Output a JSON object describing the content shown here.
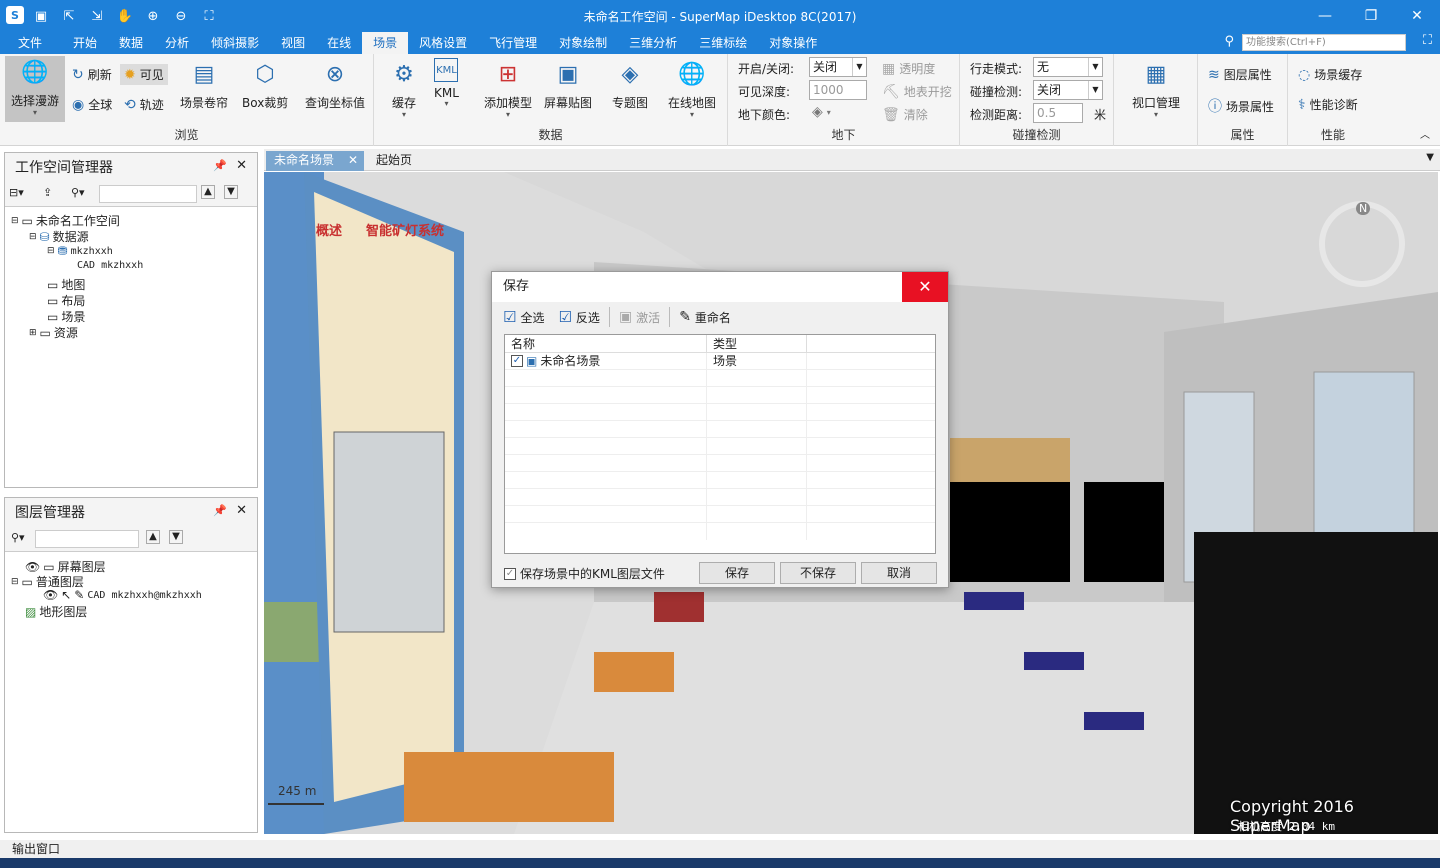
{
  "window": {
    "title": "未命名工作空间 - SuperMap iDesktop 8C(2017)"
  },
  "menu": {
    "items": [
      "文件",
      "开始",
      "数据",
      "分析",
      "倾斜摄影",
      "视图",
      "在线",
      "场景",
      "风格设置",
      "飞行管理",
      "对象绘制",
      "三维分析",
      "三维标绘",
      "对象操作"
    ],
    "active": "场景",
    "search_placeholder": "功能搜索(Ctrl+F)"
  },
  "ribbon": {
    "browse": {
      "label": "浏览",
      "select_roam": "选择漫游",
      "refresh": "刷新",
      "visible": "可见",
      "full_globe": "全球",
      "track": "轨迹",
      "scene_curtain": "场景卷帘",
      "box_clip": "Box裁剪",
      "query_coord": "查询坐标值"
    },
    "data": {
      "label": "数据",
      "cache": "缓存",
      "kml": "KML",
      "add_model": "添加模型",
      "screen_map": "屏幕贴图",
      "thematic": "专题图",
      "online_map": "在线地图"
    },
    "underground": {
      "label": "地下",
      "onoff_label": "开启/关闭:",
      "onoff_value": "关闭",
      "depth_label": "可见深度:",
      "depth_value": "1000",
      "color_label": "地下颜色:",
      "transparency": "透明度",
      "excavate": "地表开挖",
      "clear": "清除"
    },
    "collision": {
      "label": "碰撞检测",
      "walk_label": "行走模式:",
      "walk_value": "无",
      "detect_label": "碰撞检测:",
      "detect_value": "关闭",
      "dist_label": "检测距离:",
      "dist_value": "0.5",
      "dist_unit": "米"
    },
    "viewport": {
      "label": "视口管理"
    },
    "props": {
      "label": "属性",
      "layer_props": "图层属性",
      "scene_props": "场景属性"
    },
    "perf": {
      "label": "性能",
      "scene_cache": "场景缓存",
      "perf_diag": "性能诊断"
    }
  },
  "workspace_panel": {
    "title": "工作空间管理器",
    "tree": [
      "未命名工作空间",
      "数据源",
      "mkzhxxh",
      "CAD mkzhxxh",
      "地图",
      "布局",
      "场景",
      "资源"
    ]
  },
  "layer_panel": {
    "title": "图层管理器",
    "tree": [
      "屏幕图层",
      "普通图层",
      "CAD mkzhxxh@mkzhxxh",
      "地形图层"
    ]
  },
  "tabs": [
    "未命名场景",
    "起始页"
  ],
  "scene": {
    "scale_label": "245 m",
    "copyright": "Copyright 2016 SuperMap",
    "camera": "相机高度 2.04 km",
    "compass": "N",
    "poster_title": "智能矿灯系统",
    "poster_section": "概述"
  },
  "dialog": {
    "title": "保存",
    "select_all": "全选",
    "invert": "反选",
    "activate": "激活",
    "rename": "重命名",
    "col_name": "名称",
    "col_type": "类型",
    "rows": [
      {
        "name": "未命名场景",
        "type": "场景"
      }
    ],
    "save_kml": "保存场景中的KML图层文件",
    "save": "保存",
    "nosave": "不保存",
    "cancel": "取消"
  },
  "output": {
    "label": "输出窗口"
  }
}
